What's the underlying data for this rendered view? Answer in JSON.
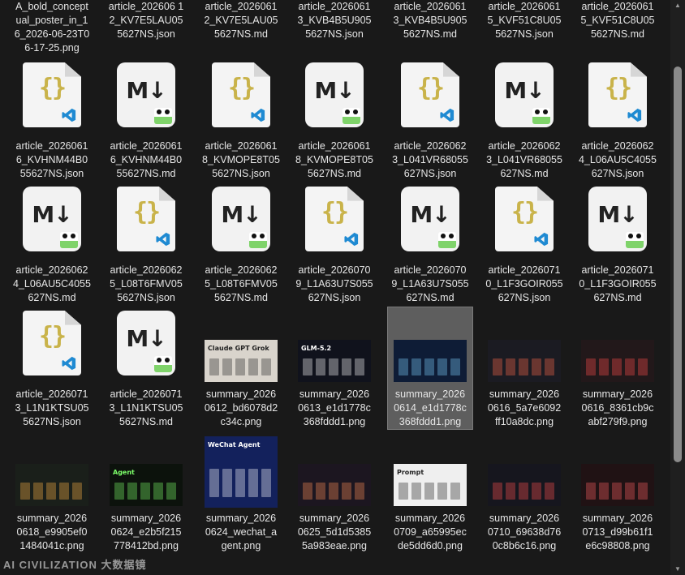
{
  "explorer": {
    "items": [
      {
        "type": "label",
        "name": "A_bold_concept\nual_poster_in_1\n6_2026-06-23T0\n6-17-25.png"
      },
      {
        "type": "label",
        "name": "article_202606 1\n2_KV7E5LAU05\n5627NS.json"
      },
      {
        "type": "label",
        "name": "article_2026061\n2_KV7E5LAU05\n5627NS.md"
      },
      {
        "type": "label",
        "name": "article_2026061\n3_KVB4B5U905\n5627NS.json"
      },
      {
        "type": "label",
        "name": "article_2026061\n3_KVB4B5U905\n5627NS.md"
      },
      {
        "type": "label",
        "name": "article_2026061\n5_KVF51C8U05\n5627NS.json"
      },
      {
        "type": "label",
        "name": "article_2026061\n5_KVF51C8U05\n5627NS.md"
      },
      {
        "type": "json",
        "name": "article_2026061\n6_KVHNM44B0\n55627NS.json"
      },
      {
        "type": "md",
        "name": "article_2026061\n6_KVHNM44B0\n55627NS.md"
      },
      {
        "type": "json",
        "name": "article_2026061\n8_KVMOPE8T05\n5627NS.json"
      },
      {
        "type": "md",
        "name": "article_2026061\n8_KVMOPE8T05\n5627NS.md"
      },
      {
        "type": "json",
        "name": "article_2026062\n3_L041VR68055\n627NS.json"
      },
      {
        "type": "md",
        "name": "article_2026062\n3_L041VR68055\n627NS.md"
      },
      {
        "type": "json",
        "name": "article_2026062\n4_L06AU5C4055\n627NS.json"
      },
      {
        "type": "md",
        "name": "article_2026062\n4_L06AU5C4055\n627NS.md"
      },
      {
        "type": "json",
        "name": "article_2026062\n5_L08T6FMV05\n5627NS.json"
      },
      {
        "type": "md",
        "name": "article_2026062\n5_L08T6FMV05\n5627NS.md"
      },
      {
        "type": "json",
        "name": "article_2026070\n9_L1A63U7S055\n627NS.json"
      },
      {
        "type": "md",
        "name": "article_2026070\n9_L1A63U7S055\n627NS.md"
      },
      {
        "type": "json",
        "name": "article_2026071\n0_L1F3GOIR055\n627NS.json"
      },
      {
        "type": "md",
        "name": "article_2026071\n0_L1F3GOIR055\n627NS.md"
      },
      {
        "type": "json",
        "name": "article_2026071\n3_L1N1KTSU05\n5627NS.json"
      },
      {
        "type": "md",
        "name": "article_2026071\n3_L1N1KTSU05\n5627NS.md"
      },
      {
        "type": "img",
        "name": "summary_2026\n0612_bd6078d2\nc34c.png",
        "bg": "#d9d4cc",
        "fg": "#222222",
        "text": "Claude GPT Grok"
      },
      {
        "type": "img",
        "name": "summary_2026\n0613_e1d1778c\n368fddd1.png",
        "bg": "#10121c",
        "fg": "#ffffff",
        "text": "GLM-5.2"
      },
      {
        "type": "img",
        "name": "summary_2026\n0614_e1d1778c\n368fddd1.png",
        "bg": "#0e1c36",
        "fg": "#7fd0ff",
        "text": "",
        "selected": true
      },
      {
        "type": "img",
        "name": "summary_2026\n0616_5a7e6092\nff10a8dc.png",
        "bg": "#1b1b22",
        "fg": "#ff6b4a",
        "text": ""
      },
      {
        "type": "img",
        "name": "summary_2026\n0616_8361cb9c\nabf279f9.png",
        "bg": "#22181a",
        "fg": "#ff4d4d",
        "text": ""
      },
      {
        "type": "img",
        "name": "summary_2026\n0618_e9905ef0\n1484041c.png",
        "bg": "#1a1f1a",
        "fg": "#ffb347",
        "text": ""
      },
      {
        "type": "img",
        "name": "summary_2026\n0624_e2b5f215\n778412bd.png",
        "bg": "#0c120c",
        "fg": "#7dff6a",
        "text": "Agent"
      },
      {
        "type": "img",
        "name": "summary_2026\n0624_wechat_a\ngent.png",
        "bg": "#13215c",
        "fg": "#ffffff",
        "text": "WeChat Agent",
        "tall": true
      },
      {
        "type": "img",
        "name": "summary_2026\n0625_5d1d5385\n5a983eae.png",
        "bg": "#1c1620",
        "fg": "#ff8f5a",
        "text": ""
      },
      {
        "type": "img",
        "name": "summary_2026\n0709_a65995ec\nde5dd6d0.png",
        "bg": "#efefef",
        "fg": "#222222",
        "text": "Prompt"
      },
      {
        "type": "img",
        "name": "summary_2026\n0710_69638d76\n0c8b6c16.png",
        "bg": "#16161e",
        "fg": "#ff5050",
        "text": ""
      },
      {
        "type": "img",
        "name": "summary_2026\n0713_d99b61f1\ne6c98808.png",
        "bg": "#201214",
        "fg": "#ff6060",
        "text": ""
      }
    ]
  },
  "scrollbar": {
    "up_icon": "▲",
    "down_icon": "▼"
  },
  "watermark": {
    "text": "AI CIVILIZATION 大数据镜"
  }
}
